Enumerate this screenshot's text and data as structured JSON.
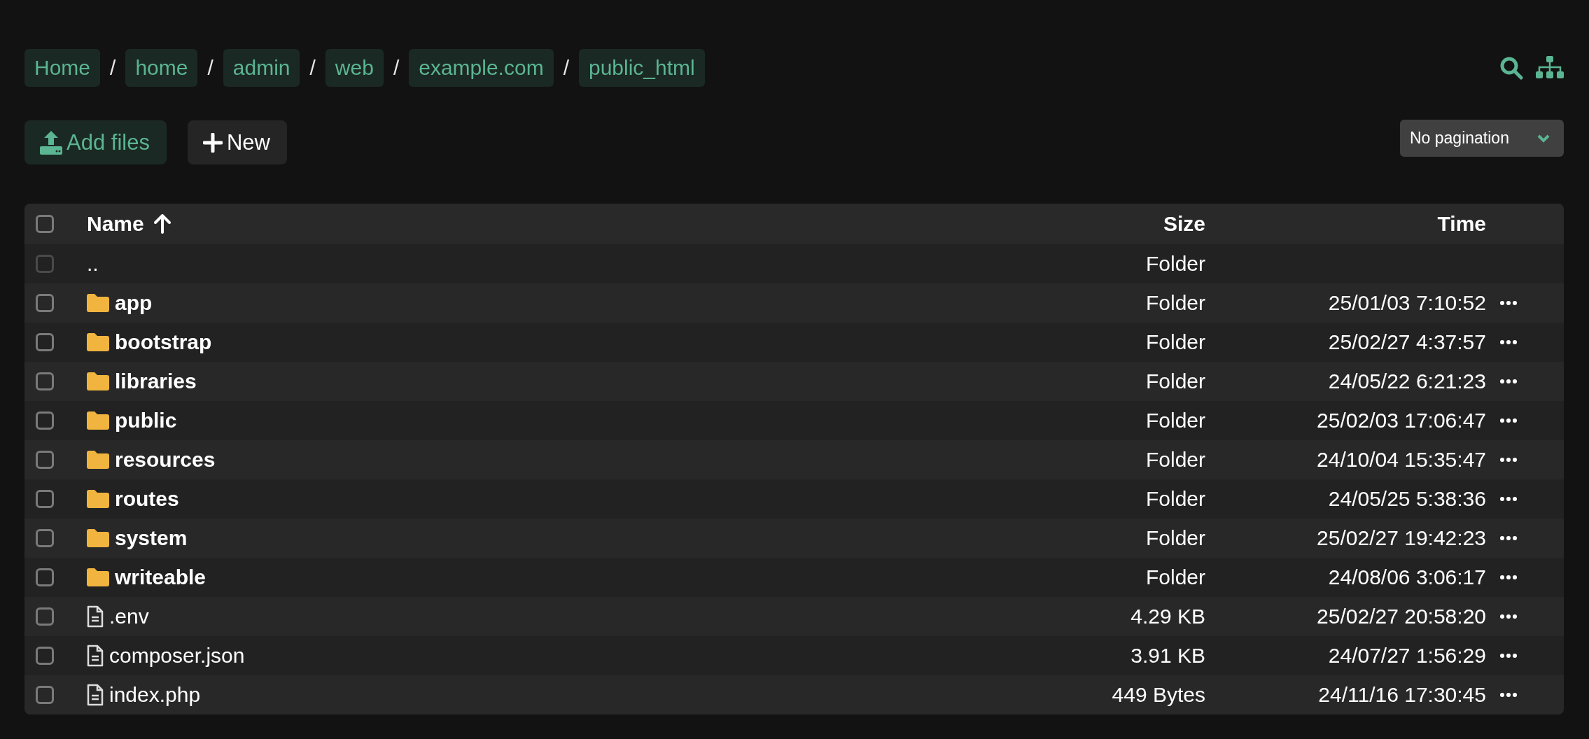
{
  "breadcrumbs": [
    "Home",
    "home",
    "admin",
    "web",
    "example.com",
    "public_html"
  ],
  "separator": "/",
  "toolbar": {
    "add_files": "Add files",
    "new": "New",
    "pagination": "No pagination"
  },
  "table": {
    "all_checked": false,
    "columns": [
      {
        "label": "Name",
        "sort_ascending": true
      },
      {
        "label": "Size"
      },
      {
        "label": "Time"
      }
    ],
    "rows": [
      {
        "kind": "parent",
        "name": "..",
        "size": "Folder",
        "time": "",
        "checked": false,
        "disabled": true
      },
      {
        "kind": "folder",
        "name": "app",
        "size": "Folder",
        "time": "25/01/03 7:10:52",
        "checked": false,
        "disabled": false
      },
      {
        "kind": "folder",
        "name": "bootstrap",
        "size": "Folder",
        "time": "25/02/27 4:37:57",
        "checked": false,
        "disabled": false
      },
      {
        "kind": "folder",
        "name": "libraries",
        "size": "Folder",
        "time": "24/05/22 6:21:23",
        "checked": false,
        "disabled": false
      },
      {
        "kind": "folder",
        "name": "public",
        "size": "Folder",
        "time": "25/02/03 17:06:47",
        "checked": false,
        "disabled": false
      },
      {
        "kind": "folder",
        "name": "resources",
        "size": "Folder",
        "time": "24/10/04 15:35:47",
        "checked": false,
        "disabled": false
      },
      {
        "kind": "folder",
        "name": "routes",
        "size": "Folder",
        "time": "24/05/25 5:38:36",
        "checked": false,
        "disabled": false
      },
      {
        "kind": "folder",
        "name": "system",
        "size": "Folder",
        "time": "25/02/27 19:42:23",
        "checked": false,
        "disabled": false
      },
      {
        "kind": "folder",
        "name": "writeable",
        "size": "Folder",
        "time": "24/08/06 3:06:17",
        "checked": false,
        "disabled": false
      },
      {
        "kind": "file",
        "name": ".env",
        "size": "4.29 KB",
        "time": "25/02/27 20:58:20",
        "checked": false,
        "disabled": false
      },
      {
        "kind": "file",
        "name": "composer.json",
        "size": "3.91 KB",
        "time": "24/07/27 1:56:29",
        "checked": false,
        "disabled": false
      },
      {
        "kind": "file",
        "name": "index.php",
        "size": "449 Bytes",
        "time": "24/11/16 17:30:45",
        "checked": false,
        "disabled": false
      }
    ]
  }
}
